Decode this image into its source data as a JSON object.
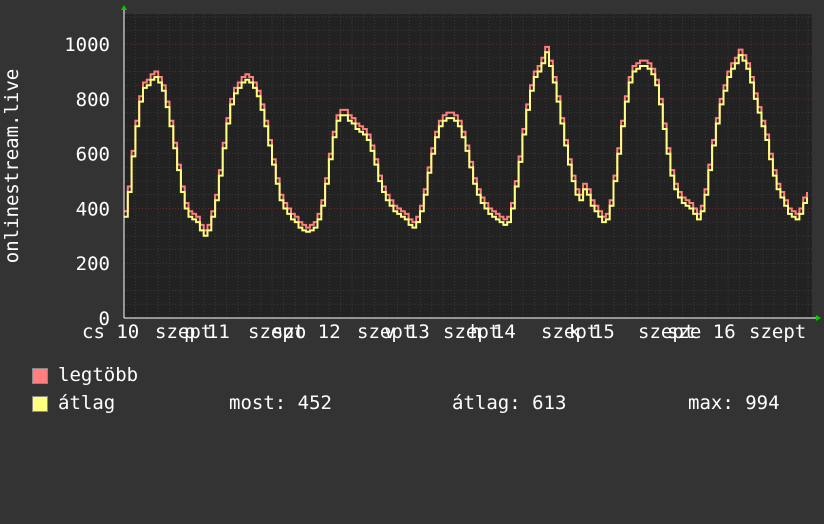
{
  "chart_data": {
    "type": "line",
    "ylabel": "onlinestream.live",
    "ylim": [
      0,
      1110
    ],
    "yticks": [
      0,
      200,
      400,
      600,
      800,
      1000
    ],
    "x_tick_labels": [
      "cs 10",
      "szept",
      "p 11",
      "szept",
      "szo 12",
      "szept",
      "v 13",
      "szept",
      "h 14",
      "szept",
      "k 15",
      "szept",
      "sze 16",
      "szept"
    ],
    "grid": true,
    "legend_position": "bottom",
    "series": [
      {
        "name": "legtöbb",
        "color": "#ff7f7f",
        "values": [
          390,
          480,
          610,
          720,
          810,
          860,
          870,
          890,
          900,
          880,
          850,
          790,
          720,
          640,
          560,
          480,
          420,
          390,
          380,
          370,
          340,
          320,
          340,
          390,
          450,
          540,
          640,
          730,
          800,
          840,
          860,
          880,
          890,
          880,
          860,
          830,
          780,
          720,
          650,
          580,
          510,
          450,
          420,
          400,
          380,
          370,
          350,
          340,
          330,
          340,
          350,
          380,
          430,
          510,
          600,
          680,
          740,
          760,
          760,
          740,
          730,
          710,
          700,
          690,
          670,
          630,
          580,
          520,
          480,
          450,
          430,
          410,
          400,
          390,
          380,
          360,
          350,
          370,
          410,
          470,
          550,
          620,
          680,
          720,
          740,
          750,
          750,
          740,
          720,
          680,
          630,
          570,
          510,
          470,
          440,
          420,
          400,
          390,
          380,
          370,
          360,
          370,
          420,
          500,
          590,
          690,
          780,
          850,
          900,
          920,
          950,
          990,
          940,
          880,
          810,
          730,
          650,
          580,
          520,
          470,
          450,
          490,
          470,
          430,
          410,
          390,
          370,
          380,
          430,
          520,
          620,
          720,
          810,
          880,
          920,
          930,
          940,
          940,
          930,
          910,
          870,
          800,
          710,
          620,
          540,
          490,
          460,
          440,
          430,
          420,
          400,
          380,
          410,
          470,
          560,
          650,
          730,
          800,
          850,
          900,
          930,
          950,
          980,
          960,
          930,
          880,
          820,
          770,
          720,
          670,
          600,
          540,
          490,
          460,
          430,
          400,
          390,
          380,
          400,
          440,
          460
        ]
      },
      {
        "name": "átlag",
        "color": "#ffff7f",
        "values": [
          370,
          460,
          590,
          700,
          790,
          840,
          850,
          870,
          880,
          860,
          830,
          770,
          700,
          620,
          540,
          460,
          400,
          370,
          360,
          350,
          320,
          300,
          320,
          370,
          430,
          520,
          620,
          710,
          780,
          820,
          840,
          860,
          870,
          860,
          840,
          810,
          760,
          700,
          630,
          560,
          490,
          430,
          400,
          380,
          360,
          350,
          330,
          320,
          315,
          320,
          330,
          360,
          410,
          490,
          580,
          660,
          720,
          740,
          740,
          720,
          710,
          690,
          680,
          670,
          650,
          610,
          560,
          500,
          460,
          430,
          410,
          390,
          380,
          370,
          360,
          340,
          330,
          350,
          390,
          450,
          530,
          600,
          660,
          700,
          720,
          730,
          730,
          720,
          700,
          660,
          610,
          550,
          490,
          450,
          420,
          400,
          380,
          370,
          360,
          350,
          340,
          350,
          400,
          480,
          570,
          670,
          760,
          830,
          880,
          900,
          930,
          970,
          920,
          860,
          790,
          710,
          630,
          560,
          500,
          450,
          430,
          470,
          450,
          410,
          390,
          370,
          350,
          360,
          410,
          500,
          600,
          700,
          790,
          860,
          900,
          910,
          920,
          920,
          910,
          890,
          850,
          780,
          690,
          600,
          520,
          470,
          440,
          420,
          410,
          400,
          380,
          360,
          390,
          450,
          540,
          630,
          710,
          780,
          830,
          880,
          910,
          930,
          960,
          940,
          910,
          860,
          800,
          750,
          700,
          650,
          580,
          520,
          470,
          440,
          410,
          380,
          370,
          360,
          380,
          420,
          440
        ]
      }
    ]
  },
  "legend": {
    "max_label": "legtöbb",
    "avg_label": "átlag",
    "now_text": "most: 452",
    "avg_text": "átlag: 613",
    "peak_text": "max: 994"
  },
  "colors": {
    "background": "#333333",
    "plot_background": "#222222",
    "grid": "#6a2a2a",
    "axis": "#ffffff",
    "arrow": "#00cc00"
  }
}
